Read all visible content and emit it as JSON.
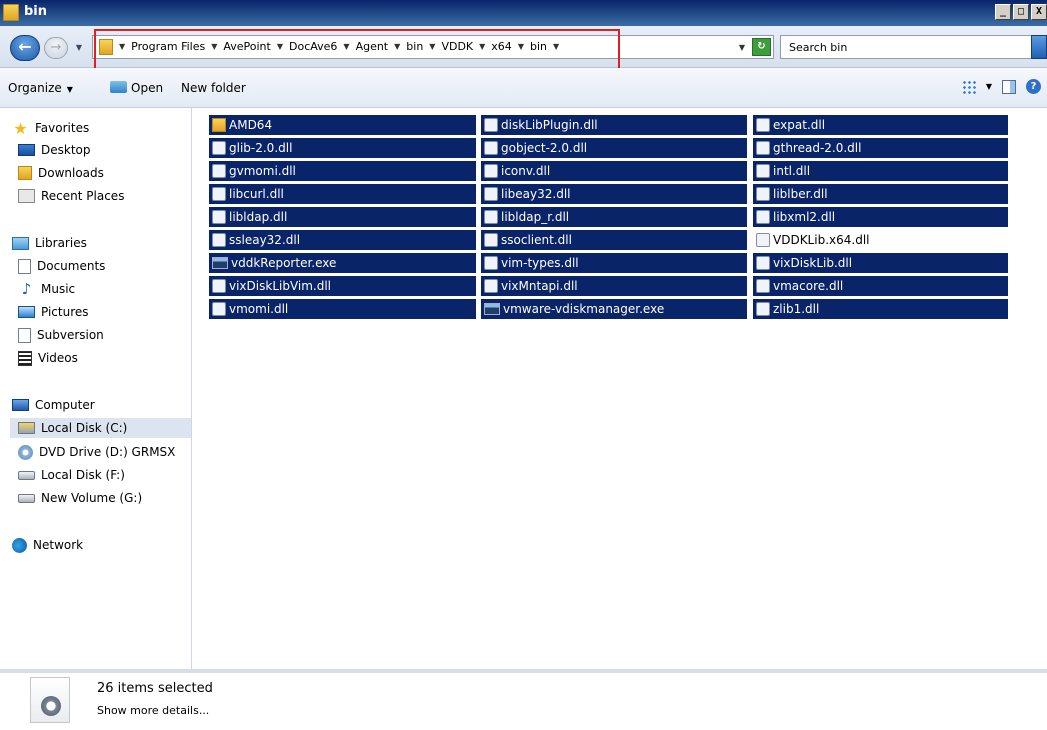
{
  "window": {
    "title": "bin",
    "buttons": [
      "_",
      "□",
      "X"
    ]
  },
  "address": {
    "crumbs": [
      "Program Files",
      "AvePoint",
      "DocAve6",
      "Agent",
      "bin",
      "VDDK",
      "x64",
      "bin"
    ],
    "search_placeholder": "Search bin"
  },
  "toolbar": {
    "organize": "Organize",
    "open": "Open",
    "new_folder": "New folder"
  },
  "nav": {
    "favorites": "Favorites",
    "desktop": "Desktop",
    "downloads": "Downloads",
    "recent": "Recent Places",
    "libraries": "Libraries",
    "documents": "Documents",
    "music": "Music",
    "pictures": "Pictures",
    "subversion": "Subversion",
    "videos": "Videos",
    "computer": "Computer",
    "disk_c": "Local Disk (C:)",
    "dvd_d": "DVD Drive (D:) GRMSX",
    "disk_f": "Local Disk (F:)",
    "vol_g": "New Volume (G:)",
    "network": "Network"
  },
  "files": [
    {
      "name": "AMD64",
      "type": "folder",
      "selected": true
    },
    {
      "name": "diskLibPlugin.dll",
      "type": "dll",
      "selected": true
    },
    {
      "name": "expat.dll",
      "type": "dll",
      "selected": true
    },
    {
      "name": "glib-2.0.dll",
      "type": "dll",
      "selected": true
    },
    {
      "name": "gobject-2.0.dll",
      "type": "dll",
      "selected": true
    },
    {
      "name": "gthread-2.0.dll",
      "type": "dll",
      "selected": true
    },
    {
      "name": "gvmomi.dll",
      "type": "dll",
      "selected": true
    },
    {
      "name": "iconv.dll",
      "type": "dll",
      "selected": true
    },
    {
      "name": "intl.dll",
      "type": "dll",
      "selected": true
    },
    {
      "name": "libcurl.dll",
      "type": "dll",
      "selected": true
    },
    {
      "name": "libeay32.dll",
      "type": "dll",
      "selected": true
    },
    {
      "name": "liblber.dll",
      "type": "dll",
      "selected": true
    },
    {
      "name": "libldap.dll",
      "type": "dll",
      "selected": true
    },
    {
      "name": "libldap_r.dll",
      "type": "dll",
      "selected": true
    },
    {
      "name": "libxml2.dll",
      "type": "dll",
      "selected": true
    },
    {
      "name": "ssleay32.dll",
      "type": "dll",
      "selected": true
    },
    {
      "name": "ssoclient.dll",
      "type": "dll",
      "selected": true
    },
    {
      "name": "VDDKLib.x64.dll",
      "type": "dll",
      "selected": false
    },
    {
      "name": "vddkReporter.exe",
      "type": "exe",
      "selected": true
    },
    {
      "name": "vim-types.dll",
      "type": "dll",
      "selected": true
    },
    {
      "name": "vixDiskLib.dll",
      "type": "dll",
      "selected": true
    },
    {
      "name": "vixDiskLibVim.dll",
      "type": "dll",
      "selected": true
    },
    {
      "name": "vixMntapi.dll",
      "type": "dll",
      "selected": true
    },
    {
      "name": "vmacore.dll",
      "type": "dll",
      "selected": true
    },
    {
      "name": "vmomi.dll",
      "type": "dll",
      "selected": true
    },
    {
      "name": "vmware-vdiskmanager.exe",
      "type": "exe",
      "selected": true
    },
    {
      "name": "zlib1.dll",
      "type": "dll",
      "selected": true
    }
  ],
  "details": {
    "count": "26 items selected",
    "more": "Show more details..."
  }
}
